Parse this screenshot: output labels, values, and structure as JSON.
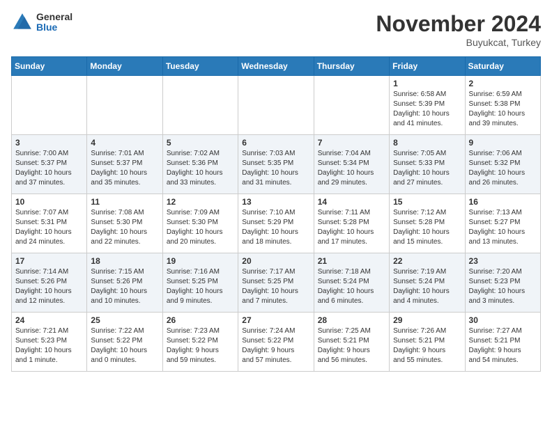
{
  "header": {
    "logo_general": "General",
    "logo_blue": "Blue",
    "month_title": "November 2024",
    "location": "Buyukcat, Turkey"
  },
  "weekdays": [
    "Sunday",
    "Monday",
    "Tuesday",
    "Wednesday",
    "Thursday",
    "Friday",
    "Saturday"
  ],
  "weeks": [
    [
      {
        "day": "",
        "info": ""
      },
      {
        "day": "",
        "info": ""
      },
      {
        "day": "",
        "info": ""
      },
      {
        "day": "",
        "info": ""
      },
      {
        "day": "",
        "info": ""
      },
      {
        "day": "1",
        "info": "Sunrise: 6:58 AM\nSunset: 5:39 PM\nDaylight: 10 hours\nand 41 minutes."
      },
      {
        "day": "2",
        "info": "Sunrise: 6:59 AM\nSunset: 5:38 PM\nDaylight: 10 hours\nand 39 minutes."
      }
    ],
    [
      {
        "day": "3",
        "info": "Sunrise: 7:00 AM\nSunset: 5:37 PM\nDaylight: 10 hours\nand 37 minutes."
      },
      {
        "day": "4",
        "info": "Sunrise: 7:01 AM\nSunset: 5:37 PM\nDaylight: 10 hours\nand 35 minutes."
      },
      {
        "day": "5",
        "info": "Sunrise: 7:02 AM\nSunset: 5:36 PM\nDaylight: 10 hours\nand 33 minutes."
      },
      {
        "day": "6",
        "info": "Sunrise: 7:03 AM\nSunset: 5:35 PM\nDaylight: 10 hours\nand 31 minutes."
      },
      {
        "day": "7",
        "info": "Sunrise: 7:04 AM\nSunset: 5:34 PM\nDaylight: 10 hours\nand 29 minutes."
      },
      {
        "day": "8",
        "info": "Sunrise: 7:05 AM\nSunset: 5:33 PM\nDaylight: 10 hours\nand 27 minutes."
      },
      {
        "day": "9",
        "info": "Sunrise: 7:06 AM\nSunset: 5:32 PM\nDaylight: 10 hours\nand 26 minutes."
      }
    ],
    [
      {
        "day": "10",
        "info": "Sunrise: 7:07 AM\nSunset: 5:31 PM\nDaylight: 10 hours\nand 24 minutes."
      },
      {
        "day": "11",
        "info": "Sunrise: 7:08 AM\nSunset: 5:30 PM\nDaylight: 10 hours\nand 22 minutes."
      },
      {
        "day": "12",
        "info": "Sunrise: 7:09 AM\nSunset: 5:30 PM\nDaylight: 10 hours\nand 20 minutes."
      },
      {
        "day": "13",
        "info": "Sunrise: 7:10 AM\nSunset: 5:29 PM\nDaylight: 10 hours\nand 18 minutes."
      },
      {
        "day": "14",
        "info": "Sunrise: 7:11 AM\nSunset: 5:28 PM\nDaylight: 10 hours\nand 17 minutes."
      },
      {
        "day": "15",
        "info": "Sunrise: 7:12 AM\nSunset: 5:28 PM\nDaylight: 10 hours\nand 15 minutes."
      },
      {
        "day": "16",
        "info": "Sunrise: 7:13 AM\nSunset: 5:27 PM\nDaylight: 10 hours\nand 13 minutes."
      }
    ],
    [
      {
        "day": "17",
        "info": "Sunrise: 7:14 AM\nSunset: 5:26 PM\nDaylight: 10 hours\nand 12 minutes."
      },
      {
        "day": "18",
        "info": "Sunrise: 7:15 AM\nSunset: 5:26 PM\nDaylight: 10 hours\nand 10 minutes."
      },
      {
        "day": "19",
        "info": "Sunrise: 7:16 AM\nSunset: 5:25 PM\nDaylight: 10 hours\nand 9 minutes."
      },
      {
        "day": "20",
        "info": "Sunrise: 7:17 AM\nSunset: 5:25 PM\nDaylight: 10 hours\nand 7 minutes."
      },
      {
        "day": "21",
        "info": "Sunrise: 7:18 AM\nSunset: 5:24 PM\nDaylight: 10 hours\nand 6 minutes."
      },
      {
        "day": "22",
        "info": "Sunrise: 7:19 AM\nSunset: 5:24 PM\nDaylight: 10 hours\nand 4 minutes."
      },
      {
        "day": "23",
        "info": "Sunrise: 7:20 AM\nSunset: 5:23 PM\nDaylight: 10 hours\nand 3 minutes."
      }
    ],
    [
      {
        "day": "24",
        "info": "Sunrise: 7:21 AM\nSunset: 5:23 PM\nDaylight: 10 hours\nand 1 minute."
      },
      {
        "day": "25",
        "info": "Sunrise: 7:22 AM\nSunset: 5:22 PM\nDaylight: 10 hours\nand 0 minutes."
      },
      {
        "day": "26",
        "info": "Sunrise: 7:23 AM\nSunset: 5:22 PM\nDaylight: 9 hours\nand 59 minutes."
      },
      {
        "day": "27",
        "info": "Sunrise: 7:24 AM\nSunset: 5:22 PM\nDaylight: 9 hours\nand 57 minutes."
      },
      {
        "day": "28",
        "info": "Sunrise: 7:25 AM\nSunset: 5:21 PM\nDaylight: 9 hours\nand 56 minutes."
      },
      {
        "day": "29",
        "info": "Sunrise: 7:26 AM\nSunset: 5:21 PM\nDaylight: 9 hours\nand 55 minutes."
      },
      {
        "day": "30",
        "info": "Sunrise: 7:27 AM\nSunset: 5:21 PM\nDaylight: 9 hours\nand 54 minutes."
      }
    ]
  ]
}
